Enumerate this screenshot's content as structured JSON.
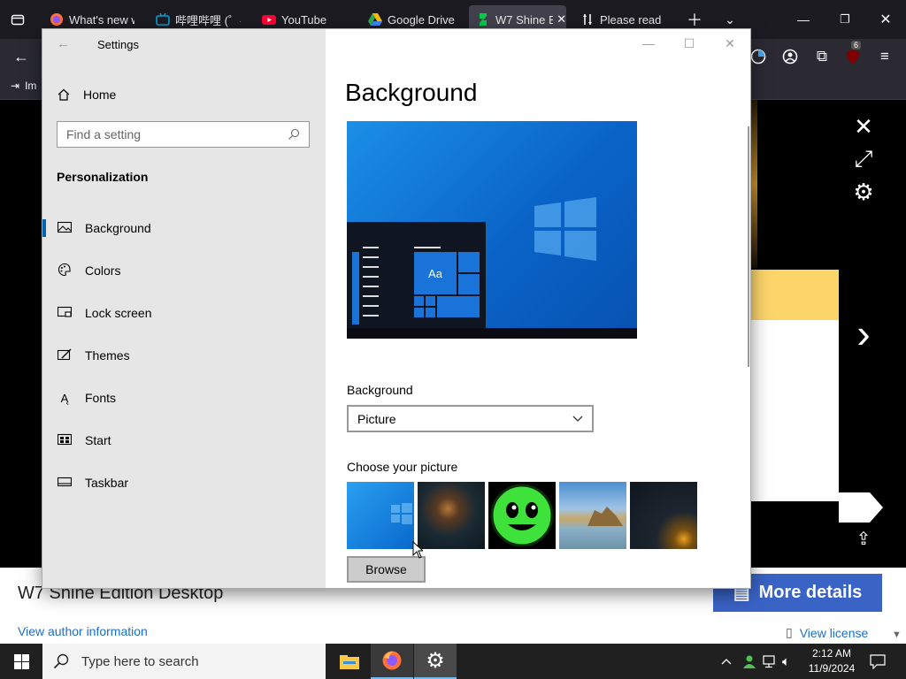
{
  "browser": {
    "tabs": [
      {
        "label": "What's new w",
        "icon": "firefox-icon"
      },
      {
        "label": "哔哩哔哩 (゜-",
        "icon": "bilibili-icon"
      },
      {
        "label": "YouTube",
        "icon": "youtube-icon"
      },
      {
        "label": "Google Drive",
        "icon": "google-drive-icon"
      },
      {
        "label": "W7 Shine E",
        "icon": "deviantart-icon",
        "active": true
      },
      {
        "label": "Please read",
        "icon": "github-icon"
      }
    ],
    "bookmark_label": "Im",
    "extension_badge": "6"
  },
  "settings": {
    "title": "Settings",
    "home": "Home",
    "search_placeholder": "Find a setting",
    "section": "Personalization",
    "nav": [
      {
        "label": "Background",
        "icon": "picture-icon",
        "selected": true
      },
      {
        "label": "Colors",
        "icon": "palette-icon"
      },
      {
        "label": "Lock screen",
        "icon": "lock-screen-icon"
      },
      {
        "label": "Themes",
        "icon": "themes-icon"
      },
      {
        "label": "Fonts",
        "icon": "fonts-icon"
      },
      {
        "label": "Start",
        "icon": "start-icon"
      },
      {
        "label": "Taskbar",
        "icon": "taskbar-icon"
      }
    ],
    "heading": "Background",
    "preview_sample": "Aa",
    "background_label": "Background",
    "background_value": "Picture",
    "choose_label": "Choose your picture",
    "browse": "Browse"
  },
  "page": {
    "title": "W7 Shine Edition Desktop",
    "author_link": "View author information",
    "more_details": "More details",
    "license_link": "View license"
  },
  "taskbar": {
    "search_placeholder": "Type here to search",
    "time": "2:12 AM",
    "date": "11/9/2024"
  },
  "colors": {
    "accent": "#0063b1",
    "more_details_bg": "#3a63c6",
    "link": "#1a6fc9"
  }
}
